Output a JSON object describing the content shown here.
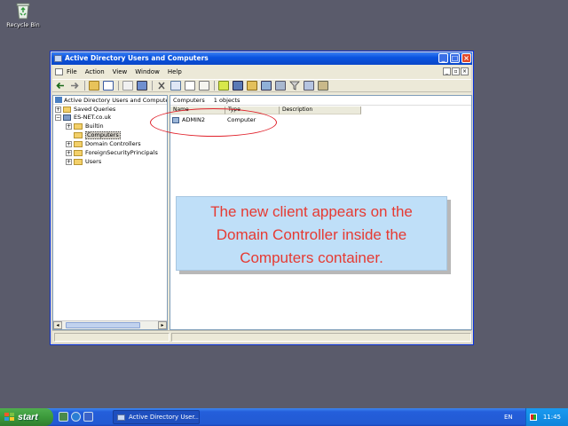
{
  "desktop": {
    "recycle_bin_label": "Recycle Bin"
  },
  "window": {
    "title": "Active Directory Users and Computers",
    "menu": [
      "File",
      "Action",
      "View",
      "Window",
      "Help"
    ]
  },
  "tree": {
    "root": "Active Directory Users and Computers",
    "domain": "ES-NET.co.uk",
    "nodes": [
      {
        "label": "Saved Queries"
      },
      {
        "label": "Builtin"
      },
      {
        "label": "Computers"
      },
      {
        "label": "Domain Controllers"
      },
      {
        "label": "ForeignSecurityPrincipals"
      },
      {
        "label": "Users"
      }
    ],
    "selected": "Computers"
  },
  "details": {
    "title": "Computers",
    "count": "1 objects",
    "columns": [
      "Name",
      "Type",
      "Description"
    ],
    "rows": [
      {
        "name": "ADMIN2",
        "type": "Computer",
        "description": ""
      }
    ]
  },
  "callout": {
    "lines": [
      "The new client appears on the",
      "Domain Controller inside the",
      "Computers container."
    ]
  },
  "taskbar": {
    "start_label": "start",
    "task_button": "Active Directory User...",
    "language": "EN",
    "clock": "11:45"
  },
  "colors": {
    "callout_text": "#e63a32",
    "callout_bg": "#bfdff8",
    "annotation_ring": "#e0202a",
    "desktop_bg": "#5a5b6b"
  }
}
